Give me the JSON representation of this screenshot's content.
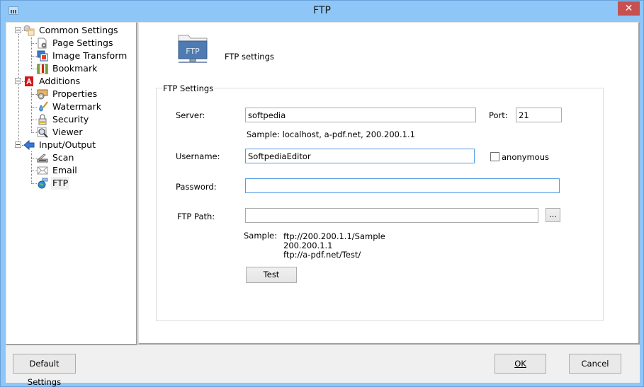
{
  "window": {
    "title": "FTP",
    "close_glyph": "✕"
  },
  "tree": {
    "items": [
      {
        "label": "Common Settings",
        "icon": "gears-icon",
        "level": 0,
        "expanded": true
      },
      {
        "label": "Page Settings",
        "icon": "page-gear-icon",
        "level": 1
      },
      {
        "label": "Image Transform",
        "icon": "image-transform-icon",
        "level": 1
      },
      {
        "label": "Bookmark",
        "icon": "book-icon",
        "level": 1
      },
      {
        "label": "Additions",
        "icon": "pdf-icon",
        "level": 0,
        "expanded": true
      },
      {
        "label": "Properties",
        "icon": "properties-icon",
        "level": 1
      },
      {
        "label": "Watermark",
        "icon": "watermark-pen-icon",
        "level": 1
      },
      {
        "label": "Security",
        "icon": "lock-icon",
        "level": 1
      },
      {
        "label": "Viewer",
        "icon": "magnifier-icon",
        "level": 1
      },
      {
        "label": "Input/Output",
        "icon": "arrow-left-icon",
        "level": 0,
        "expanded": true
      },
      {
        "label": "Scan",
        "icon": "scanner-icon",
        "level": 1
      },
      {
        "label": "Email",
        "icon": "envelope-icon",
        "level": 1
      },
      {
        "label": "FTP",
        "icon": "globe-icon",
        "level": 1,
        "selected": true
      }
    ]
  },
  "header": {
    "icon_text": "FTP",
    "title": "FTP settings"
  },
  "ftp_settings": {
    "group_label": "FTP Settings",
    "server_label": "Server:",
    "server_value": "softpedia",
    "port_label": "Port:",
    "port_value": "21",
    "server_sample": "Sample: localhost, a-pdf.net, 200.200.1.1",
    "username_label": "Username:",
    "username_value": "SoftpediaEditor",
    "anonymous_label": "anonymous",
    "anonymous_checked": false,
    "password_label": "Password:",
    "password_value": "",
    "path_label": "FTP Path:",
    "path_value": "",
    "browse_label": "...",
    "sample_label": "Sample:",
    "sample_lines": [
      "ftp://200.200.1.1/Sample",
      "200.200.1.1",
      "ftp://a-pdf.net/Test/"
    ],
    "test_label": "Test"
  },
  "footer": {
    "default_label": "Default Settings",
    "ok_label": "OK",
    "cancel_label": "Cancel"
  },
  "colors": {
    "titlebar": "#8ec6f8",
    "close_button": "#c75050",
    "focus_border": "#569de5"
  }
}
